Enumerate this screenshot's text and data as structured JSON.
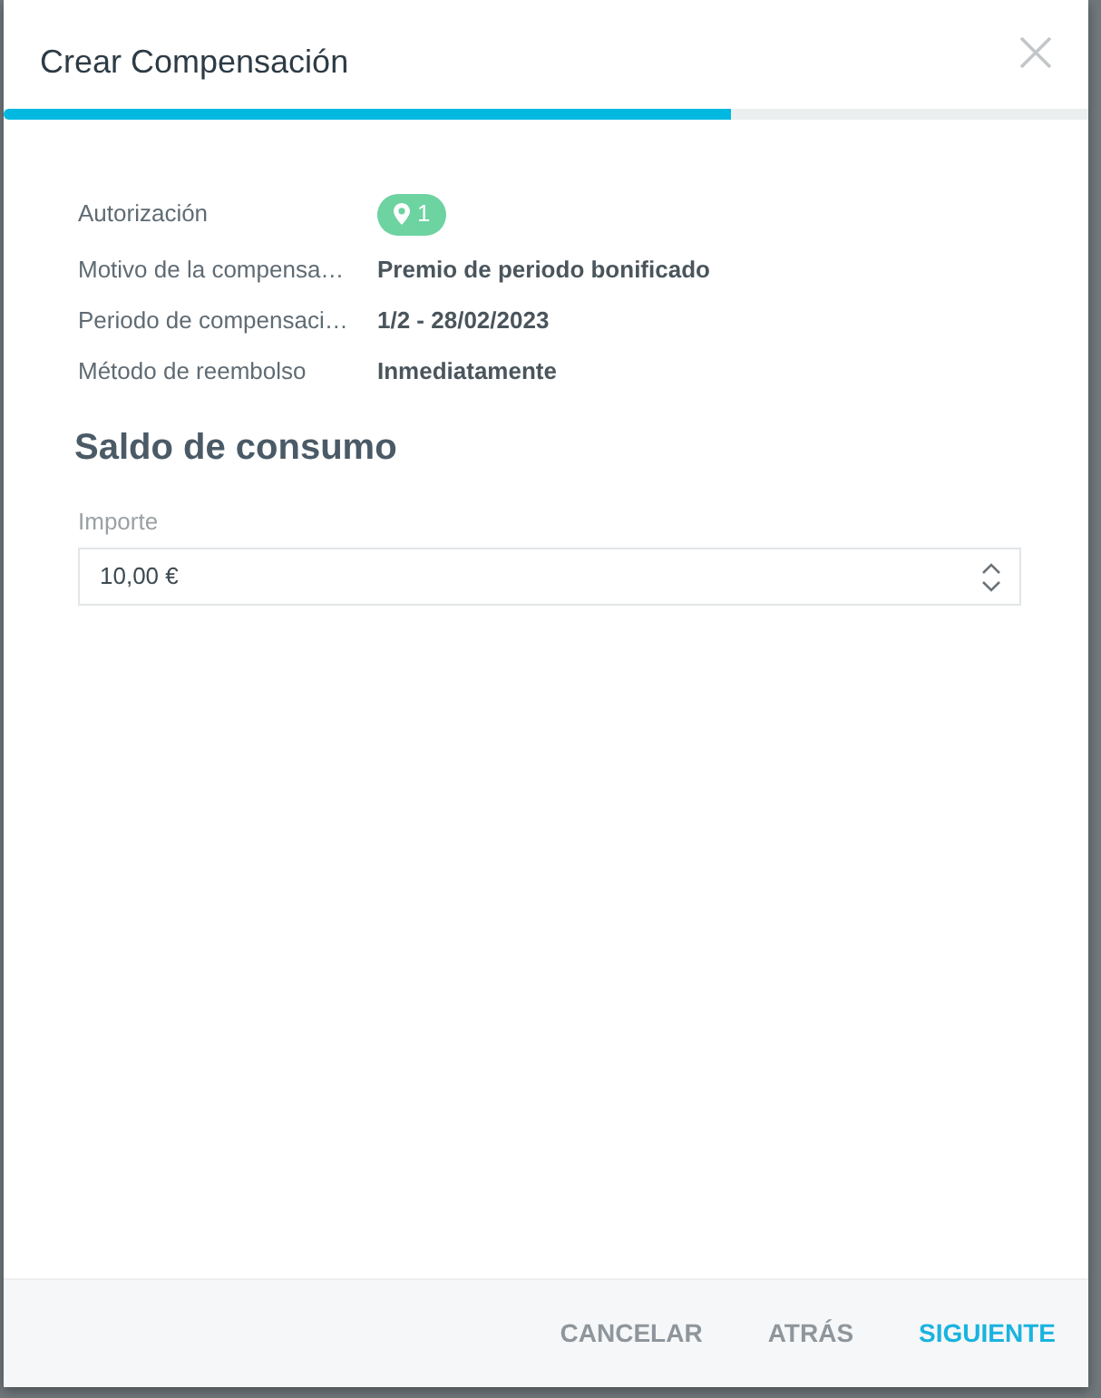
{
  "dialog": {
    "title": "Crear Compensación",
    "progress": {
      "level": 0.67
    }
  },
  "details": [
    {
      "label": "Autorización",
      "kind": "badge",
      "value": "1"
    },
    {
      "label": "Motivo de la compensa…",
      "kind": "text",
      "value": "Premio de periodo bonificado"
    },
    {
      "label": "Periodo de compensaci…",
      "kind": "text",
      "value": "1/2 - 28/02/2023"
    },
    {
      "label": "Método de reembolso",
      "kind": "text",
      "value": "Inmediatamente"
    }
  ],
  "section": {
    "title": "Saldo de consumo"
  },
  "amount_field": {
    "label": "Importe",
    "value": "10,00 €"
  },
  "buttons": [
    {
      "label": "CANCELAR",
      "kind": "secondary"
    },
    {
      "label": "ATRÁS",
      "kind": "secondary"
    },
    {
      "label": "SIGUIENTE",
      "kind": "primary"
    }
  ]
}
